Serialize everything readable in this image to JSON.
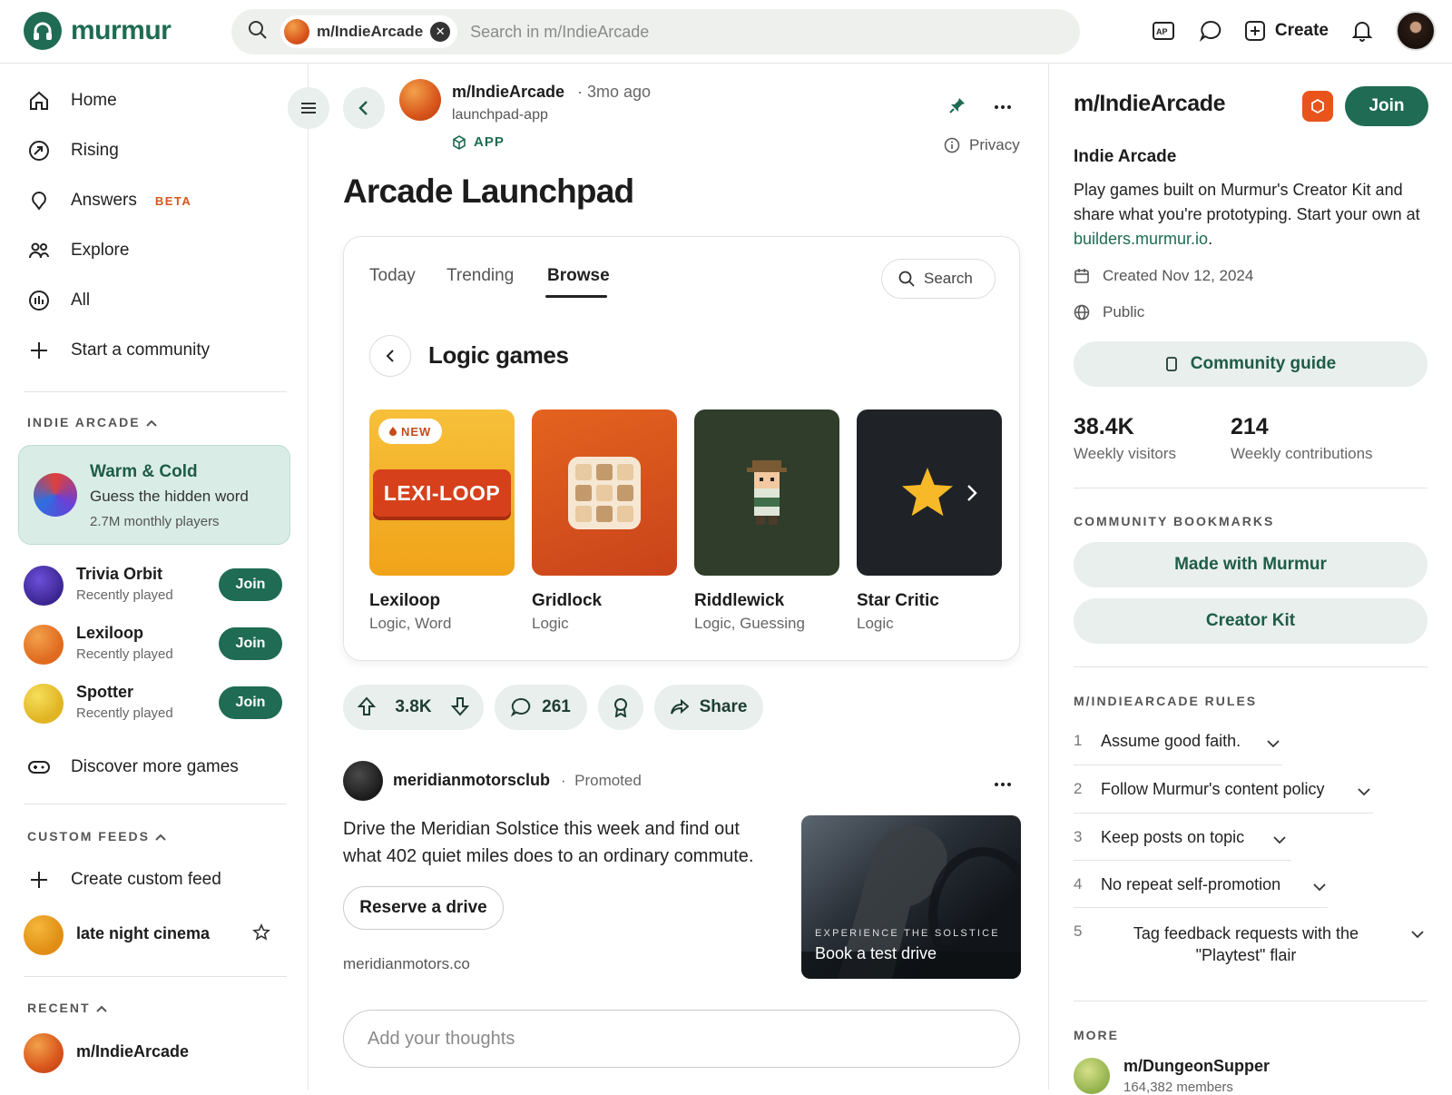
{
  "header": {
    "logo": "murmur",
    "chip_label": "m/IndieArcade",
    "search_placeholder": "Search in m/IndieArcade",
    "create_label": "Create"
  },
  "sidebar": {
    "nav": [
      {
        "label": "Home",
        "icon": "home-icon"
      },
      {
        "label": "Rising",
        "icon": "rising-icon"
      },
      {
        "label": "Answers",
        "icon": "answers-icon",
        "badge": "BETA"
      },
      {
        "label": "Explore",
        "icon": "explore-icon"
      },
      {
        "label": "All",
        "icon": "all-icon"
      },
      {
        "label": "Start a community",
        "icon": "plus-icon"
      }
    ],
    "section_indie": "INDIE ARCADE",
    "feature": {
      "title": "Warm & Cold",
      "subtitle": "Guess the hidden word",
      "stat": "2.7M monthly players"
    },
    "games": [
      {
        "name": "Trivia Orbit",
        "status": "Recently played",
        "action": "Join"
      },
      {
        "name": "Lexiloop",
        "status": "Recently played",
        "action": "Join"
      },
      {
        "name": "Spotter",
        "status": "Recently played",
        "action": "Join"
      }
    ],
    "discover": "Discover more games",
    "section_feeds": "CUSTOM FEEDS",
    "create_feed": "Create custom feed",
    "feed_item": "late night cinema",
    "section_recent": "RECENT",
    "recent_item": "m/IndieArcade"
  },
  "post": {
    "community": "m/IndieArcade",
    "time": "3mo ago",
    "user": "launchpad-app",
    "tag": "APP",
    "privacy": "Privacy",
    "title": "Arcade Launchpad"
  },
  "launchpad": {
    "tabs": [
      "Today",
      "Trending",
      "Browse"
    ],
    "active_tab": "Browse",
    "search_label": "Search",
    "category": "Logic games",
    "tiles": [
      {
        "name": "Lexiloop",
        "cats": "Logic, Word",
        "badge": "NEW",
        "logo": "LEXI-LOOP"
      },
      {
        "name": "Gridlock",
        "cats": "Logic"
      },
      {
        "name": "Riddlewick",
        "cats": "Logic, Guessing"
      },
      {
        "name": "Star Critic",
        "cats": "Logic"
      }
    ]
  },
  "actions": {
    "votes": "3.8K",
    "comments": "261",
    "share": "Share"
  },
  "promo": {
    "name": "meridianmotorsclub",
    "tag": "Promoted",
    "text": "Drive the Meridian Solstice this week and find out what 402 quiet miles does to an ordinary commute.",
    "button": "Reserve a drive",
    "domain": "meridianmotors.co",
    "image_kicker": "EXPERIENCE THE SOLSTICE",
    "image_cta": "Book a test drive"
  },
  "comment_placeholder": "Add your thoughts",
  "right": {
    "title": "m/IndieArcade",
    "join": "Join",
    "name": "Indie Arcade",
    "desc_pre": "Play games built on Murmur's Creator Kit and share what you're prototyping. Start your own at ",
    "desc_link": "builders.murmur.io",
    "desc_post": ".",
    "created": "Created Nov 12, 2024",
    "visibility": "Public",
    "guide": "Community guide",
    "stats": [
      {
        "value": "38.4K",
        "label": "Weekly visitors"
      },
      {
        "value": "214",
        "label": "Weekly contributions"
      }
    ],
    "bookmarks_title": "COMMUNITY BOOKMARKS",
    "bookmarks": [
      "Made with Murmur",
      "Creator Kit"
    ],
    "rules_title": "M/INDIEARCADE RULES",
    "rules": [
      {
        "num": "1",
        "text": "Assume good faith."
      },
      {
        "num": "2",
        "text": "Follow Murmur's content policy"
      },
      {
        "num": "3",
        "text": "Keep posts on topic"
      },
      {
        "num": "4",
        "text": "No repeat self-promotion"
      },
      {
        "num": "5",
        "text": "Tag feedback requests with the \"Playtest\" flair"
      }
    ],
    "more_title": "MORE",
    "more_item": {
      "name": "m/DungeonSupper",
      "sub": "164,382 members"
    }
  },
  "colors": {
    "accent": "#1f6b53",
    "accent_light": "#e8efec",
    "orange": "#d9561c"
  }
}
